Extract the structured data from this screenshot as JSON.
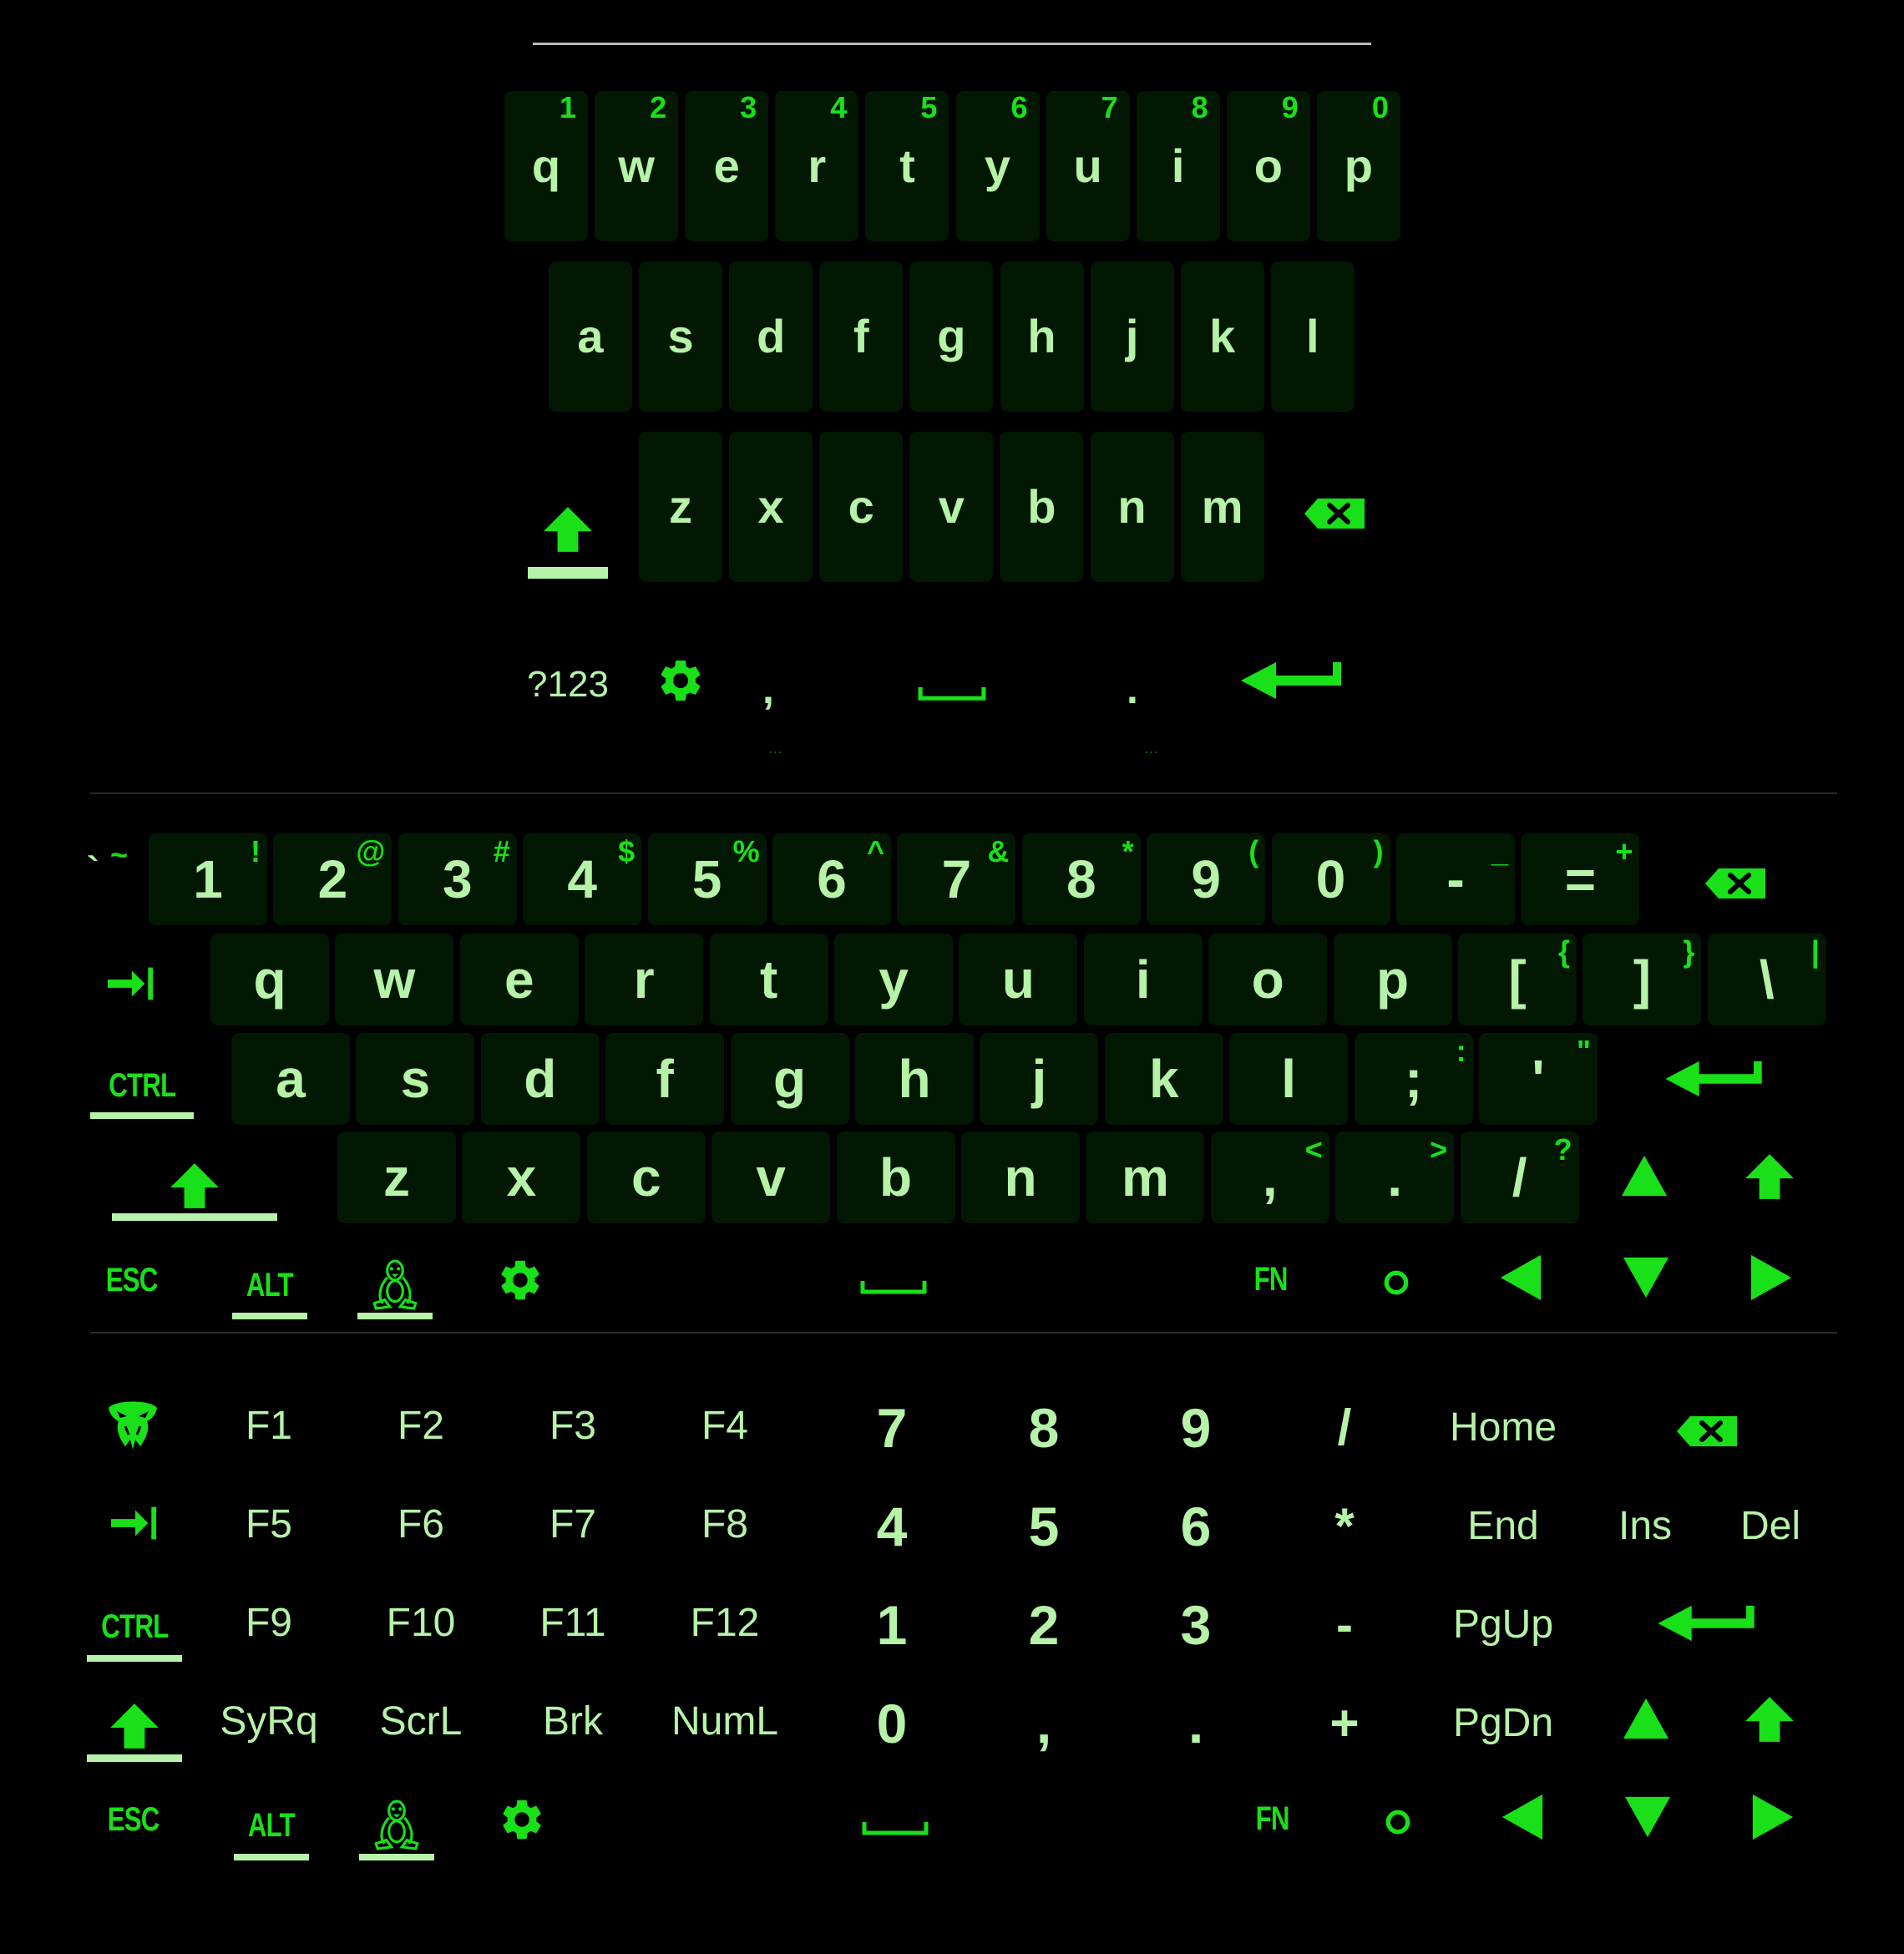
{
  "colors": {
    "background": "#000000",
    "key_background": "#021802",
    "key_text": "#b6f2a8",
    "accent": "#19e019"
  },
  "icons": [
    "shift-icon",
    "backspace-icon",
    "enter-icon",
    "settings-icon",
    "space-icon",
    "tab-icon",
    "linux-tux-icon",
    "snake-logo-icon",
    "circle-icon",
    "arrow-up-icon",
    "arrow-down-icon",
    "arrow-left-icon",
    "arrow-right-icon"
  ],
  "compact": {
    "row1": [
      {
        "label": "q",
        "hint": "1"
      },
      {
        "label": "w",
        "hint": "2"
      },
      {
        "label": "e",
        "hint": "3"
      },
      {
        "label": "r",
        "hint": "4"
      },
      {
        "label": "t",
        "hint": "5"
      },
      {
        "label": "y",
        "hint": "6"
      },
      {
        "label": "u",
        "hint": "7"
      },
      {
        "label": "i",
        "hint": "8"
      },
      {
        "label": "o",
        "hint": "9"
      },
      {
        "label": "p",
        "hint": "0"
      }
    ],
    "row2": [
      {
        "label": "a"
      },
      {
        "label": "s"
      },
      {
        "label": "d"
      },
      {
        "label": "f"
      },
      {
        "label": "g"
      },
      {
        "label": "h"
      },
      {
        "label": "j"
      },
      {
        "label": "k"
      },
      {
        "label": "l"
      }
    ],
    "row3": [
      {
        "label": "z"
      },
      {
        "label": "x"
      },
      {
        "label": "c"
      },
      {
        "label": "v"
      },
      {
        "label": "b"
      },
      {
        "label": "n"
      },
      {
        "label": "m"
      }
    ],
    "bottom": {
      "symbols": "?123",
      "comma": ",",
      "period": ".",
      "dots": "..."
    }
  },
  "full": {
    "backtick": "`",
    "tilde": "~",
    "numrow": [
      {
        "label": "1",
        "hint": "!"
      },
      {
        "label": "2",
        "hint": "@"
      },
      {
        "label": "3",
        "hint": "#"
      },
      {
        "label": "4",
        "hint": "$"
      },
      {
        "label": "5",
        "hint": "%"
      },
      {
        "label": "6",
        "hint": "^"
      },
      {
        "label": "7",
        "hint": "&"
      },
      {
        "label": "8",
        "hint": "*"
      },
      {
        "label": "9",
        "hint": "("
      },
      {
        "label": "0",
        "hint": ")"
      },
      {
        "label": "-",
        "hint": "_"
      },
      {
        "label": "=",
        "hint": "+"
      }
    ],
    "qrow": [
      {
        "label": "q"
      },
      {
        "label": "w"
      },
      {
        "label": "e"
      },
      {
        "label": "r"
      },
      {
        "label": "t"
      },
      {
        "label": "y"
      },
      {
        "label": "u"
      },
      {
        "label": "i"
      },
      {
        "label": "o"
      },
      {
        "label": "p"
      },
      {
        "label": "[",
        "hint": "{"
      },
      {
        "label": "]",
        "hint": "}"
      },
      {
        "label": "\\",
        "hint": "|"
      }
    ],
    "arow": [
      {
        "label": "a"
      },
      {
        "label": "s"
      },
      {
        "label": "d"
      },
      {
        "label": "f"
      },
      {
        "label": "g"
      },
      {
        "label": "h"
      },
      {
        "label": "j"
      },
      {
        "label": "k"
      },
      {
        "label": "l"
      },
      {
        "label": ";",
        "hint": ":"
      },
      {
        "label": "'",
        "hint": "\""
      }
    ],
    "zrow": [
      {
        "label": "z"
      },
      {
        "label": "x"
      },
      {
        "label": "c"
      },
      {
        "label": "v"
      },
      {
        "label": "b"
      },
      {
        "label": "n"
      },
      {
        "label": "m"
      },
      {
        "label": ",",
        "hint": "<"
      },
      {
        "label": ".",
        "hint": ">"
      },
      {
        "label": "/",
        "hint": "?"
      }
    ],
    "ctrl": "CTRL",
    "esc": "ESC",
    "alt": "ALT",
    "fn": "FN"
  },
  "numpad": {
    "ctrl": "CTRL",
    "esc": "ESC",
    "alt": "ALT",
    "fn": "FN",
    "fkeys": [
      [
        "F1",
        "F2",
        "F3",
        "F4"
      ],
      [
        "F5",
        "F6",
        "F7",
        "F8"
      ],
      [
        "F9",
        "F10",
        "F11",
        "F12"
      ],
      [
        "SyRq",
        "ScrL",
        "Brk",
        "NumL"
      ]
    ],
    "digits": [
      [
        "7",
        "8",
        "9"
      ],
      [
        "4",
        "5",
        "6"
      ],
      [
        "1",
        "2",
        "3"
      ],
      [
        "0",
        ",",
        "."
      ]
    ],
    "ops": [
      "/",
      "*",
      "-",
      "+"
    ],
    "nav": [
      "Home",
      "End",
      "PgUp",
      "PgDn"
    ],
    "ins": "Ins",
    "del": "Del"
  }
}
